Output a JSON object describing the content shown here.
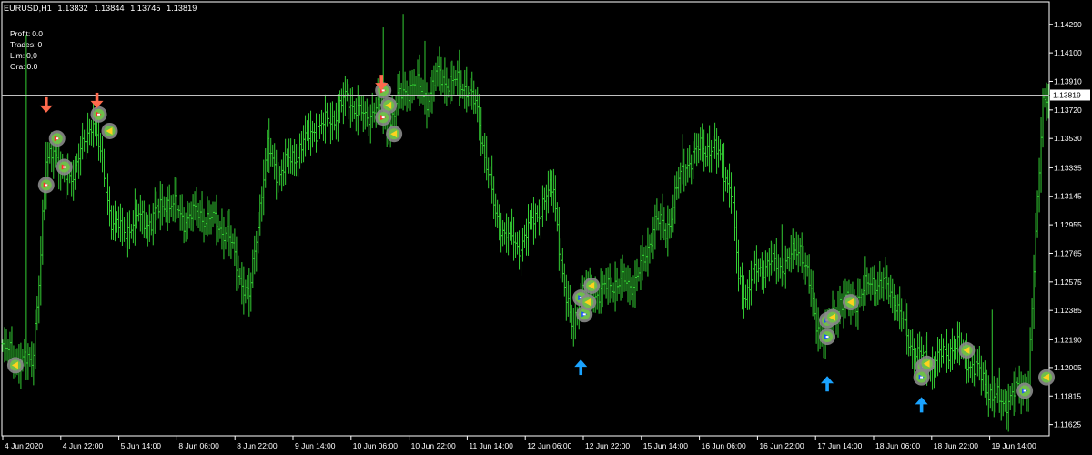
{
  "header": {
    "symbol": "EURUSD,H1",
    "open": "1.13832",
    "high": "1.13844",
    "low": "1.13745",
    "close": "1.13819"
  },
  "stats": [
    {
      "label": "Profit:",
      "value": "0.0"
    },
    {
      "label": "Trades:",
      "value": "0"
    },
    {
      "label": "Lim:",
      "value": "0,0"
    },
    {
      "label": "Ora:",
      "value": "0.0"
    }
  ],
  "colors": {
    "background": "#000000",
    "bars": "#33cc33",
    "axis": "#ffffff",
    "grid": "#2a3a4a",
    "sell_arrow": "#ff6a4d",
    "buy_arrow": "#1aa3ff",
    "price_line": "#c0c0c0"
  },
  "chart_data": {
    "type": "ohlc",
    "title": "",
    "xlabel": "",
    "ylabel": "",
    "ylim": [
      1.1155,
      1.1444
    ],
    "grid": true,
    "y_ticks": [
      "1.14290",
      "1.14100",
      "1.13910",
      "1.13720",
      "1.13530",
      "1.13335",
      "1.13145",
      "1.12955",
      "1.12765",
      "1.12575",
      "1.12385",
      "1.12190",
      "1.12005",
      "1.11815",
      "1.11625"
    ],
    "x_ticks": [
      "4 Jun 2020",
      "4 Jun 22:00",
      "5 Jun 14:00",
      "8 Jun 06:00",
      "8 Jun 22:00",
      "9 Jun 14:00",
      "10 Jun 06:00",
      "10 Jun 22:00",
      "11 Jun 14:00",
      "12 Jun 06:00",
      "12 Jun 22:00",
      "15 Jun 14:00",
      "16 Jun 06:00",
      "16 Jun 22:00",
      "17 Jun 14:00",
      "18 Jun 06:00",
      "18 Jun 22:00",
      "19 Jun 14:00"
    ],
    "current_price": "1.13819",
    "close_path": [
      {
        "i": 0,
        "p": 1.1212
      },
      {
        "i": 10,
        "p": 1.1205
      },
      {
        "i": 16,
        "p": 1.1203
      },
      {
        "i": 20,
        "p": 1.1258
      },
      {
        "i": 24,
        "p": 1.1335
      },
      {
        "i": 28,
        "p": 1.135
      },
      {
        "i": 33,
        "p": 1.1325
      },
      {
        "i": 38,
        "p": 1.133
      },
      {
        "i": 44,
        "p": 1.1345
      },
      {
        "i": 50,
        "p": 1.1368
      },
      {
        "i": 54,
        "p": 1.134
      },
      {
        "i": 60,
        "p": 1.13
      },
      {
        "i": 66,
        "p": 1.129
      },
      {
        "i": 74,
        "p": 1.13
      },
      {
        "i": 82,
        "p": 1.1298
      },
      {
        "i": 90,
        "p": 1.1312
      },
      {
        "i": 100,
        "p": 1.13
      },
      {
        "i": 108,
        "p": 1.1303
      },
      {
        "i": 116,
        "p": 1.1298
      },
      {
        "i": 124,
        "p": 1.129
      },
      {
        "i": 130,
        "p": 1.1265
      },
      {
        "i": 136,
        "p": 1.1245
      },
      {
        "i": 142,
        "p": 1.131
      },
      {
        "i": 146,
        "p": 1.1345
      },
      {
        "i": 152,
        "p": 1.133
      },
      {
        "i": 160,
        "p": 1.134
      },
      {
        "i": 166,
        "p": 1.135
      },
      {
        "i": 172,
        "p": 1.136
      },
      {
        "i": 178,
        "p": 1.1362
      },
      {
        "i": 184,
        "p": 1.137
      },
      {
        "i": 190,
        "p": 1.138
      },
      {
        "i": 196,
        "p": 1.1372
      },
      {
        "i": 200,
        "p": 1.1365
      },
      {
        "i": 206,
        "p": 1.1376
      },
      {
        "i": 212,
        "p": 1.136
      },
      {
        "i": 218,
        "p": 1.1378
      },
      {
        "i": 226,
        "p": 1.139
      },
      {
        "i": 234,
        "p": 1.138
      },
      {
        "i": 240,
        "p": 1.1395
      },
      {
        "i": 248,
        "p": 1.139
      },
      {
        "i": 256,
        "p": 1.1388
      },
      {
        "i": 262,
        "p": 1.137
      },
      {
        "i": 268,
        "p": 1.133
      },
      {
        "i": 272,
        "p": 1.13
      },
      {
        "i": 278,
        "p": 1.129
      },
      {
        "i": 284,
        "p": 1.128
      },
      {
        "i": 290,
        "p": 1.1292
      },
      {
        "i": 298,
        "p": 1.131
      },
      {
        "i": 304,
        "p": 1.132
      },
      {
        "i": 310,
        "p": 1.125
      },
      {
        "i": 314,
        "p": 1.1228
      },
      {
        "i": 318,
        "p": 1.1245
      },
      {
        "i": 322,
        "p": 1.1252
      },
      {
        "i": 330,
        "p": 1.125
      },
      {
        "i": 338,
        "p": 1.1258
      },
      {
        "i": 346,
        "p": 1.1255
      },
      {
        "i": 354,
        "p": 1.127
      },
      {
        "i": 360,
        "p": 1.13
      },
      {
        "i": 366,
        "p": 1.129
      },
      {
        "i": 372,
        "p": 1.132
      },
      {
        "i": 378,
        "p": 1.1338
      },
      {
        "i": 384,
        "p": 1.1345
      },
      {
        "i": 390,
        "p": 1.1348
      },
      {
        "i": 396,
        "p": 1.134
      },
      {
        "i": 402,
        "p": 1.1318
      },
      {
        "i": 406,
        "p": 1.126
      },
      {
        "i": 410,
        "p": 1.125
      },
      {
        "i": 416,
        "p": 1.1265
      },
      {
        "i": 422,
        "p": 1.127
      },
      {
        "i": 428,
        "p": 1.1268
      },
      {
        "i": 434,
        "p": 1.1272
      },
      {
        "i": 440,
        "p": 1.1282
      },
      {
        "i": 444,
        "p": 1.1262
      },
      {
        "i": 448,
        "p": 1.1235
      },
      {
        "i": 452,
        "p": 1.1222
      },
      {
        "i": 456,
        "p": 1.1228
      },
      {
        "i": 462,
        "p": 1.1245
      },
      {
        "i": 468,
        "p": 1.1243
      },
      {
        "i": 474,
        "p": 1.125
      },
      {
        "i": 480,
        "p": 1.1258
      },
      {
        "i": 486,
        "p": 1.1255
      },
      {
        "i": 492,
        "p": 1.1248
      },
      {
        "i": 496,
        "p": 1.1232
      },
      {
        "i": 500,
        "p": 1.1218
      },
      {
        "i": 506,
        "p": 1.1208
      },
      {
        "i": 512,
        "p": 1.1202
      },
      {
        "i": 518,
        "p": 1.1208
      },
      {
        "i": 524,
        "p": 1.1215
      },
      {
        "i": 530,
        "p": 1.121
      },
      {
        "i": 536,
        "p": 1.12
      },
      {
        "i": 542,
        "p": 1.1192
      },
      {
        "i": 546,
        "p": 1.118
      },
      {
        "i": 552,
        "p": 1.1178
      },
      {
        "i": 558,
        "p": 1.1182
      },
      {
        "i": 562,
        "p": 1.1188
      },
      {
        "i": 566,
        "p": 1.119
      },
      {
        "i": 574,
        "p": 1.1382
      }
    ],
    "highlights": [
      {
        "i": 13,
        "p": 1.1422
      },
      {
        "i": 210,
        "p": 1.1427
      },
      {
        "i": 221,
        "p": 1.1436
      },
      {
        "i": 233,
        "p": 1.1418
      },
      {
        "i": 252,
        "p": 1.1412
      },
      {
        "i": 375,
        "p": 1.1356
      },
      {
        "i": 392,
        "p": 1.1355
      },
      {
        "i": 430,
        "p": 1.1296
      },
      {
        "i": 546,
        "p": 1.1239
      }
    ],
    "trade_markers": [
      {
        "i": 7,
        "p": 1.1202,
        "kind": "close"
      },
      {
        "i": 24,
        "p": 1.1322,
        "kind": "sell-entry"
      },
      {
        "i": 30,
        "p": 1.1353,
        "kind": "sell-entry"
      },
      {
        "i": 34,
        "p": 1.1334,
        "kind": "sell-entry"
      },
      {
        "i": 53,
        "p": 1.1369,
        "kind": "sell-entry"
      },
      {
        "i": 59,
        "p": 1.1358,
        "kind": "close"
      },
      {
        "i": 210,
        "p": 1.1385,
        "kind": "sell-entry"
      },
      {
        "i": 213,
        "p": 1.1375,
        "kind": "close"
      },
      {
        "i": 210,
        "p": 1.1367,
        "kind": "sell-entry"
      },
      {
        "i": 216,
        "p": 1.1356,
        "kind": "close"
      },
      {
        "i": 319,
        "p": 1.1247,
        "kind": "buy-entry"
      },
      {
        "i": 321,
        "p": 1.1236,
        "kind": "buy-entry"
      },
      {
        "i": 323,
        "p": 1.1244,
        "kind": "close"
      },
      {
        "i": 325,
        "p": 1.1255,
        "kind": "close"
      },
      {
        "i": 455,
        "p": 1.1232,
        "kind": "buy-entry"
      },
      {
        "i": 458,
        "p": 1.1234,
        "kind": "close"
      },
      {
        "i": 455,
        "p": 1.1221,
        "kind": "buy-entry"
      },
      {
        "i": 468,
        "p": 1.1244,
        "kind": "close"
      },
      {
        "i": 508,
        "p": 1.1201,
        "kind": "buy-entry"
      },
      {
        "i": 510,
        "p": 1.1203,
        "kind": "close"
      },
      {
        "i": 507,
        "p": 1.1194,
        "kind": "buy-entry"
      },
      {
        "i": 532,
        "p": 1.1212,
        "kind": "close"
      },
      {
        "i": 564,
        "p": 1.1185,
        "kind": "buy-entry"
      },
      {
        "i": 576,
        "p": 1.1194,
        "kind": "close"
      }
    ],
    "signal_arrows": [
      {
        "i": 24,
        "p": 1.1375,
        "dir": "down"
      },
      {
        "i": 52,
        "p": 1.1378,
        "dir": "down"
      },
      {
        "i": 209,
        "p": 1.139,
        "dir": "down"
      },
      {
        "i": 319,
        "p": 1.1201,
        "dir": "up"
      },
      {
        "i": 455,
        "p": 1.119,
        "dir": "up"
      },
      {
        "i": 507,
        "p": 1.1176,
        "dir": "up"
      }
    ]
  }
}
